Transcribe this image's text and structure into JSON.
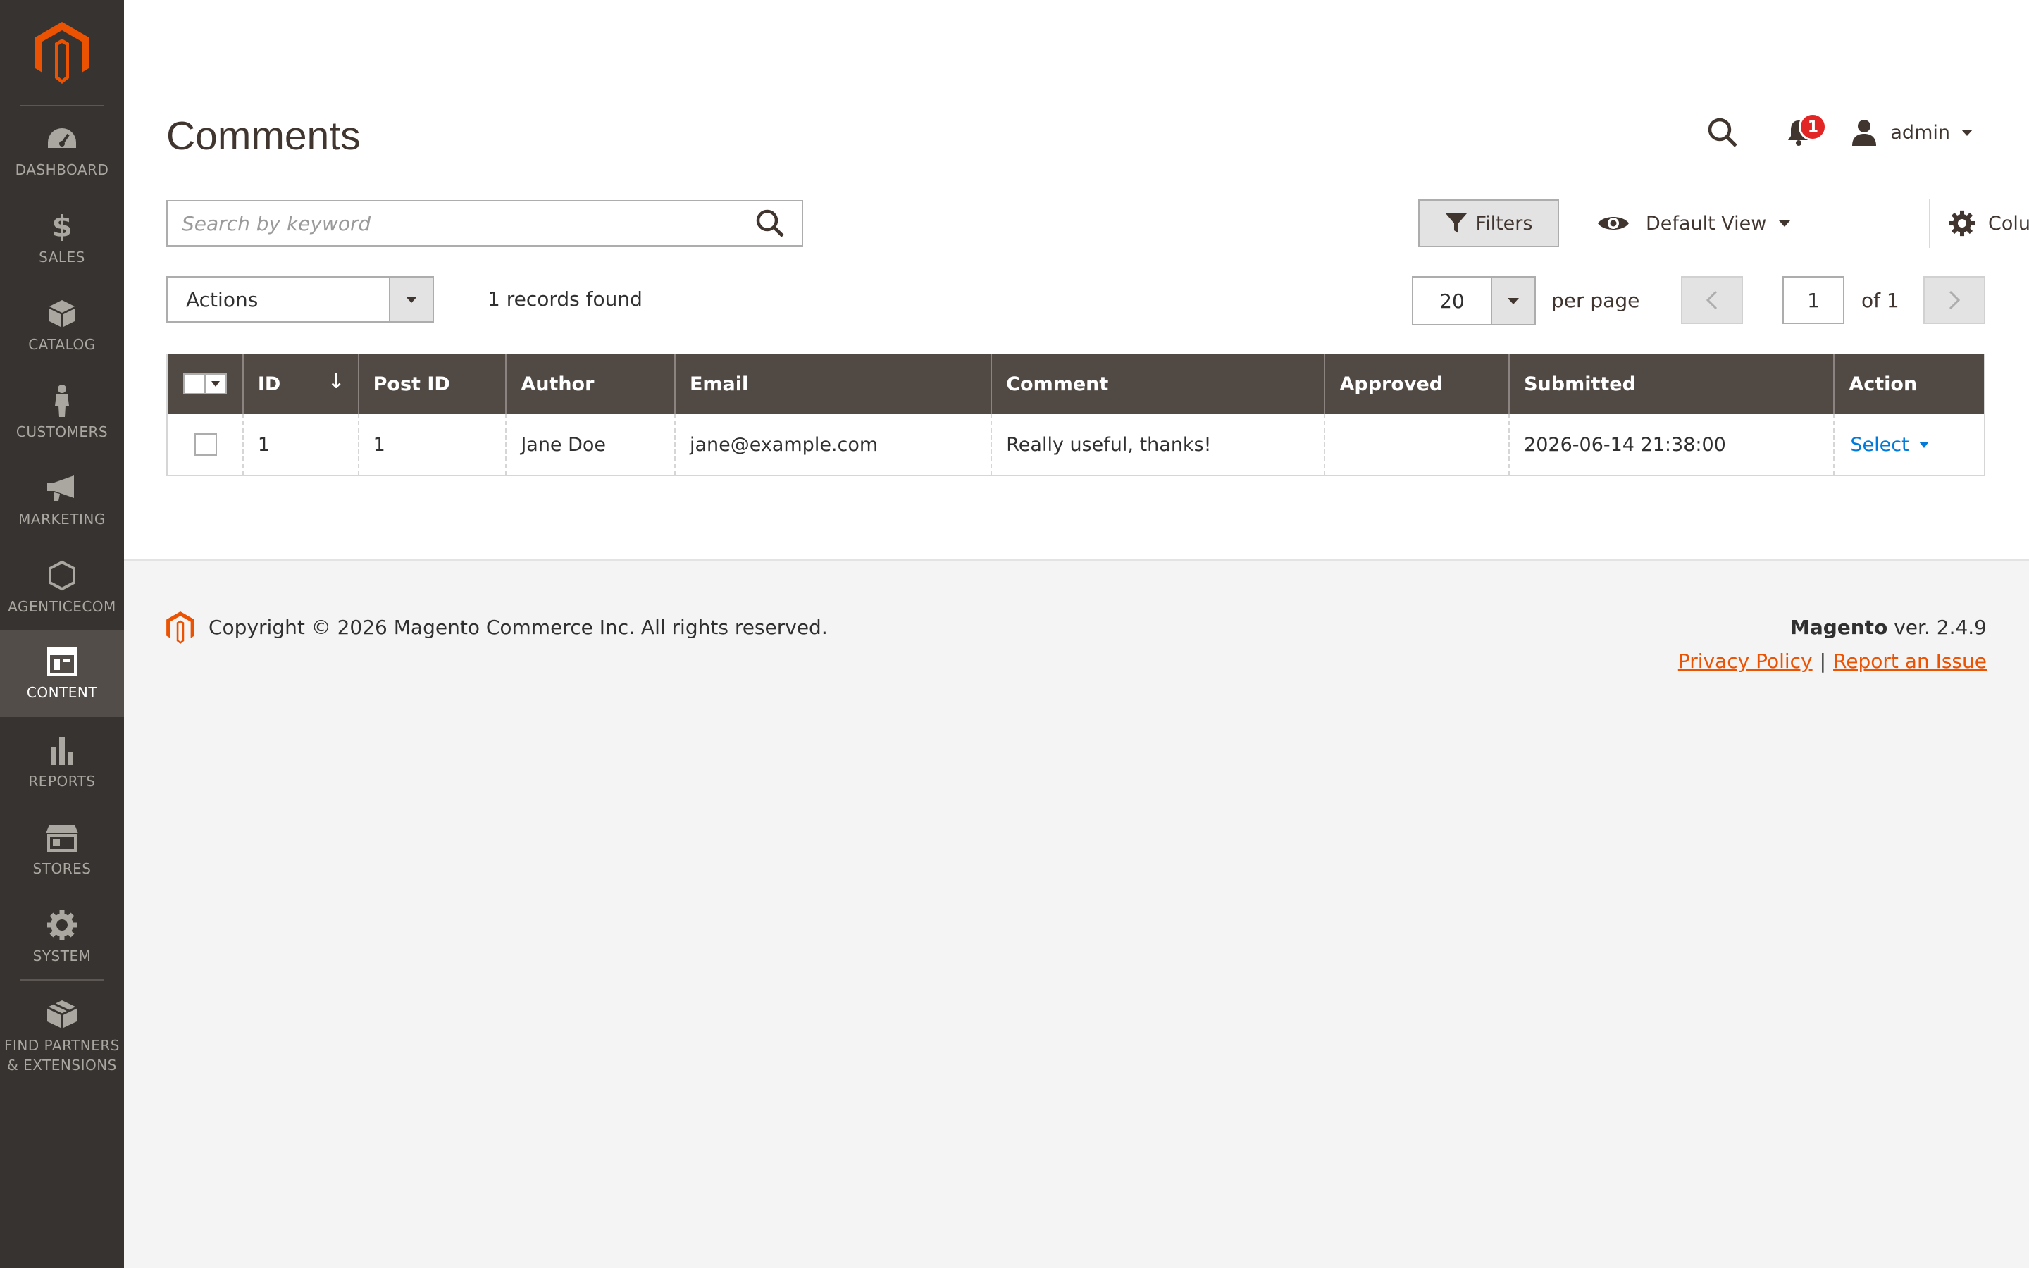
{
  "sidebar": {
    "items": [
      {
        "label": "DASHBOARD",
        "icon": "dashboard-icon"
      },
      {
        "label": "SALES",
        "icon": "dollar-icon"
      },
      {
        "label": "CATALOG",
        "icon": "cube-icon"
      },
      {
        "label": "CUSTOMERS",
        "icon": "person-icon"
      },
      {
        "label": "MARKETING",
        "icon": "megaphone-icon"
      },
      {
        "label": "AGENTICECOM",
        "icon": "hexagon-icon"
      },
      {
        "label": "CONTENT",
        "icon": "layout-icon",
        "active": true
      },
      {
        "label": "REPORTS",
        "icon": "bar-chart-icon"
      },
      {
        "label": "STORES",
        "icon": "storefront-icon"
      },
      {
        "label": "SYSTEM",
        "icon": "gear-icon"
      },
      {
        "label_line1": "FIND PARTNERS",
        "label_line2": "& EXTENSIONS",
        "icon": "boxes-icon"
      }
    ]
  },
  "header": {
    "title": "Comments",
    "notifications_count": "1",
    "user_name": "admin"
  },
  "toolbar": {
    "search_placeholder": "Search by keyword",
    "filters_label": "Filters",
    "view_label": "Default View",
    "columns_label": "Columns",
    "actions_label": "Actions",
    "records_found": "1 records found",
    "per_page_value": "20",
    "per_page_label": "per page",
    "current_page": "1",
    "total_pages_label": "of 1"
  },
  "grid": {
    "columns": [
      "ID",
      "Post ID",
      "Author",
      "Email",
      "Comment",
      "Approved",
      "Submitted",
      "Action"
    ],
    "sort_indicator": "↓",
    "rows": [
      {
        "id": "1",
        "post_id": "1",
        "author": "Jane Doe",
        "email": "jane@example.com",
        "comment": "Really useful, thanks!",
        "approved": "",
        "submitted": "2026-06-14 21:38:00",
        "action": "Select"
      }
    ]
  },
  "footer": {
    "copyright": "Copyright © 2026 Magento Commerce Inc. All rights reserved.",
    "brand": "Magento",
    "version": " ver. 2.4.9",
    "privacy_link": "Privacy Policy",
    "separator": "|",
    "report_link": "Report an Issue"
  },
  "colors": {
    "sidebar_bg": "#373330",
    "brand_orange": "#eb5202",
    "grid_header": "#514943",
    "link_blue": "#007bdb",
    "badge_red": "#e22626"
  }
}
